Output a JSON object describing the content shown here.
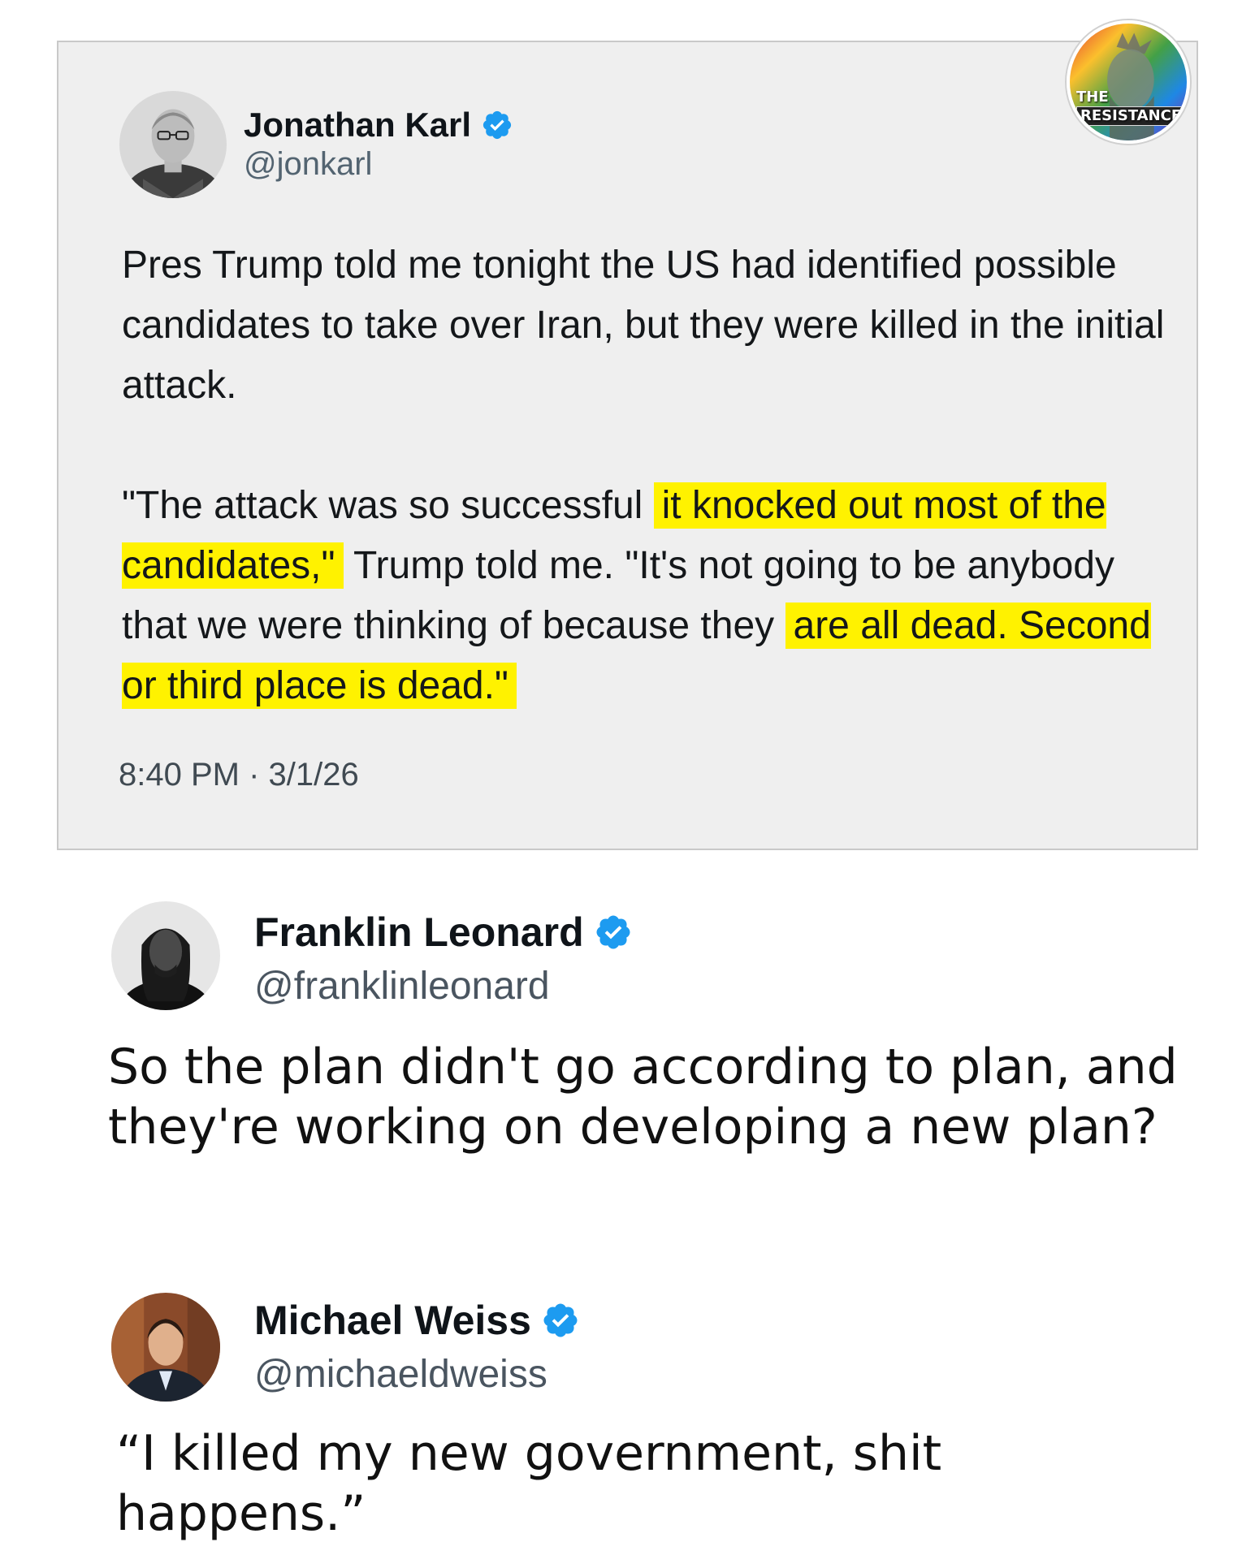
{
  "quoted_tweet": {
    "author_name": "Jonathan Karl",
    "handle": "@jonkarl",
    "paragraph1": "Pres Trump told me tonight the US had identified possible candidates to take over Iran, but they were killed in the initial attack.",
    "paragraph2": {
      "part1": "\"The attack was so successful ",
      "highlight1": "it knocked out most of the candidates,\"",
      "part2": " Trump told me. \"It's not going to be anybody that we were thinking of because they ",
      "highlight2": "are all dead. Second or third place is dead.\""
    },
    "timestamp": "8:40 PM · 3/1/26",
    "highlight_color": "#fff200"
  },
  "badge": {
    "line1": "THE",
    "line2": "RESISTANCE"
  },
  "replies": [
    {
      "author_name": "Franklin Leonard",
      "handle": "@franklinleonard",
      "text": "So the plan didn't go according to plan, and they're working on developing a new plan?"
    },
    {
      "author_name": "Michael Weiss",
      "handle": "@michaeldweiss",
      "text": "“I killed my new government, shit happens.”"
    }
  ],
  "colors": {
    "verified": "#1d9bf0",
    "card_background": "#efefef"
  }
}
